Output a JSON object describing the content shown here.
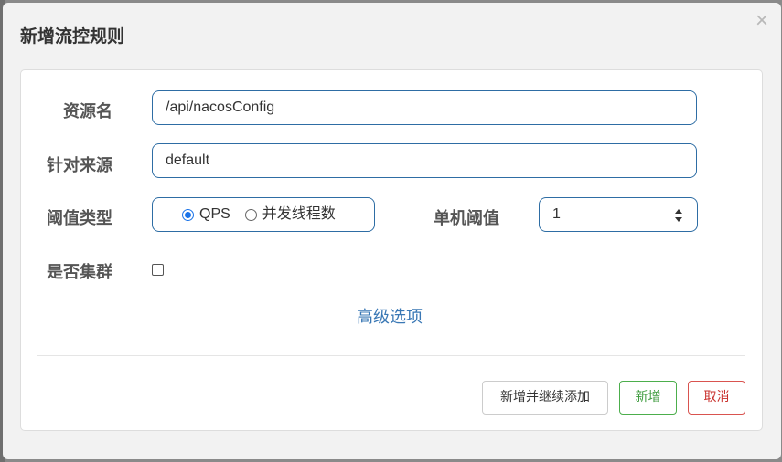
{
  "dialog": {
    "title": "新增流控规则",
    "close_glyph": "×"
  },
  "form": {
    "resource_label": "资源名",
    "resource_value": "/api/nacosConfig",
    "origin_label": "针对来源",
    "origin_value": "default",
    "threshold_type_label": "阈值类型",
    "threshold_type_options": [
      {
        "label": "QPS",
        "checked": true
      },
      {
        "label": "并发线程数",
        "checked": false
      }
    ],
    "single_threshold_label": "单机阈值",
    "single_threshold_value": "1",
    "cluster_label": "是否集群",
    "cluster_checked": false,
    "advanced_link": "高级选项"
  },
  "footer": {
    "add_continue_label": "新增并继续添加",
    "add_label": "新增",
    "cancel_label": "取消"
  },
  "colors": {
    "accent": "#1a73e8",
    "input_border": "#2e6da4",
    "link": "#3a78b5",
    "success": "#3c9a3c",
    "danger": "#c9302c"
  }
}
